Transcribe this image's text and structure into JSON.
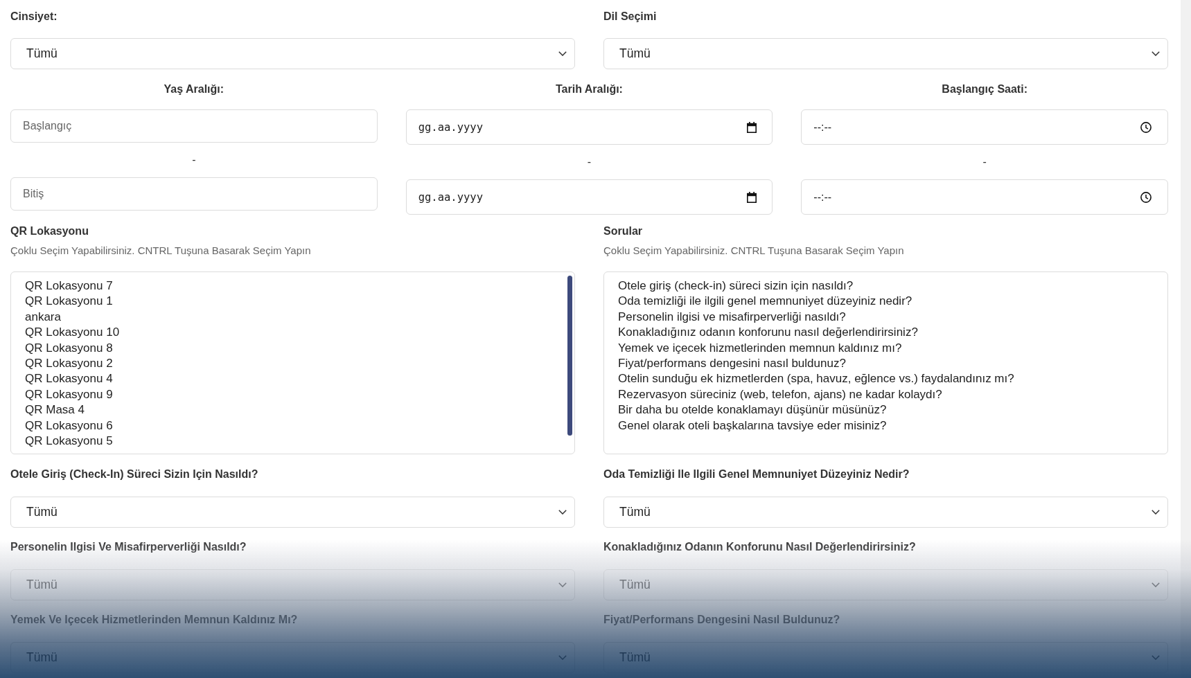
{
  "filters": [
    {
      "label": "Cinsiyet:",
      "value": "Tümü"
    },
    {
      "label": "Dil Seçimi",
      "value": "Tümü"
    }
  ],
  "ranges": [
    {
      "label": "Yaş Aralığı:",
      "kind": "text",
      "fields": [
        {
          "placeholder": "Başlangıç"
        },
        {
          "placeholder": "Bitiş"
        }
      ],
      "separator": "-"
    },
    {
      "label": "Tarih Aralığı:",
      "kind": "date",
      "fields": [
        {
          "value": "gg.aa.yyyy"
        },
        {
          "value": "gg.aa.yyyy"
        }
      ],
      "separator": "-"
    },
    {
      "label": "Başlangıç Saati:",
      "kind": "time",
      "fields": [
        {
          "value": "--:--"
        },
        {
          "value": "--:--"
        }
      ],
      "separator": "-"
    }
  ],
  "listboxes": [
    {
      "label": "QR Lokasyonu",
      "hint": "Çoklu Seçim Yapabilirsiniz. CNTRL Tuşuna Basarak Seçim Yapın",
      "options": [
        {
          "label": "QR Lokasyonu 7",
          "selected": false
        },
        {
          "label": "QR Lokasyonu 1",
          "selected": false
        },
        {
          "label": "ankara",
          "selected": false
        },
        {
          "label": "QR Lokasyonu 10",
          "selected": false
        },
        {
          "label": "QR Lokasyonu 8",
          "selected": false
        },
        {
          "label": "QR Lokasyonu 2",
          "selected": false
        },
        {
          "label": "QR Lokasyonu 4",
          "selected": false
        },
        {
          "label": "QR Lokasyonu 9",
          "selected": false
        },
        {
          "label": "QR Masa 4",
          "selected": false
        },
        {
          "label": "QR Lokasyonu 6",
          "selected": false
        },
        {
          "label": "QR Lokasyonu 5",
          "selected": false
        }
      ]
    },
    {
      "label": "Sorular",
      "hint": "Çoklu Seçim Yapabilirsiniz. CNTRL Tuşuna Basarak Seçim Yapın",
      "options": [
        {
          "label": "Otele giriş (check-in) süreci sizin için nasıldı?",
          "selected": false
        },
        {
          "label": "Oda temizliği ile ilgili genel memnuniyet düzeyiniz nedir?",
          "selected": false
        },
        {
          "label": "Personelin ilgisi ve misafirperverliği nasıldı?",
          "selected": false
        },
        {
          "label": "Konakladığınız odanın konforunu nasıl değerlendirirsiniz?",
          "selected": false
        },
        {
          "label": "Yemek ve içecek hizmetlerinden memnun kaldınız mı?",
          "selected": false
        },
        {
          "label": "Fiyat/performans dengesini nasıl buldunuz?",
          "selected": false
        },
        {
          "label": "Otelin sunduğu ek hizmetlerden (spa, havuz, eğlence vs.) faydalandınız mı?",
          "selected": false
        },
        {
          "label": "Rezervasyon süreciniz (web, telefon, ajans) ne kadar kolaydı?",
          "selected": false
        },
        {
          "label": "Bir daha bu otelde konaklamayı düşünür müsünüz?",
          "selected": false
        },
        {
          "label": "Genel olarak oteli başkalarına tavsiye eder misiniz?",
          "selected": false
        }
      ]
    }
  ],
  "question_filters": [
    {
      "label": "Otele Giriş (Check-In) Süreci Sizin Için Nasıldı?",
      "value": "Tümü"
    },
    {
      "label": "Oda Temizliği Ile Ilgili Genel Memnuniyet Düzeyiniz Nedir?",
      "value": "Tümü"
    },
    {
      "label": "Personelin Ilgisi Ve Misafirperverliği Nasıldı?",
      "value": "Tümü"
    },
    {
      "label": "Konakladığınız Odanın Konforunu Nasıl Değerlendirirsiniz?",
      "value": "Tümü"
    },
    {
      "label": "Yemek Ve Içecek Hizmetlerinden Memnun Kaldınız Mı?",
      "value": "Tümü"
    },
    {
      "label": "Fiyat/Performans Dengesini Nasıl Buldunuz?",
      "value": "Tümü"
    }
  ]
}
